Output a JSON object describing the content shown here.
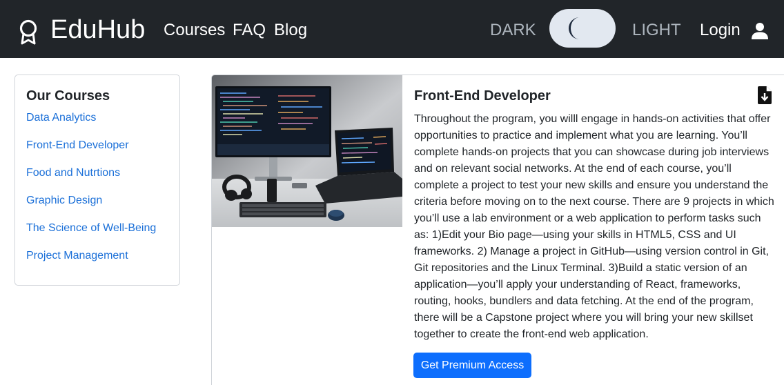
{
  "navbar": {
    "brand": "EduHub",
    "links": [
      "Courses",
      "FAQ",
      "Blog"
    ],
    "theme_dark_label": "DARK",
    "theme_light_label": "LIGHT",
    "login_label": "Login",
    "background_color": "#212529",
    "toggle_color": "#e2e8f0"
  },
  "sidebar": {
    "title": "Our Courses",
    "items": [
      "Data Analytics",
      "Front-End Developer",
      "Food and Nutrtions",
      "Graphic Design",
      "The Science of Well-Being",
      "Project Management"
    ],
    "link_color": "#1a6fd8"
  },
  "course": {
    "title": "Front-End Developer",
    "description": "Throughout the program, you willl engage in hands-on activities that offer opportunities to practice and implement what you are learning. You’ll complete hands-on projects that you can showcase during job interviews and on relevant social networks. At the end of each course, you’ll complete a project to test your new skills and ensure you understand the criteria before moving on to the next course. There are 9 projects in which you’ll use a lab environment or a web application to perform tasks such as: 1)Edit your Bio page—using your skills in HTML5, CSS and UI frameworks. 2) Manage a project in GitHub—using version control in Git, Git repositories and the Linux Terminal. 3)Build a static version of an application—you’ll apply your understanding of React, frameworks, routing, hooks, bundlers and data fetching. At the end of the program, there will be a Capstone project where you will bring your new skillset together to create the front-end web application.",
    "button_label": "Get Premium Access",
    "button_color": "#0d6efd",
    "image_icon": "desk-setup-photo",
    "download_icon": "file-download-icon"
  }
}
